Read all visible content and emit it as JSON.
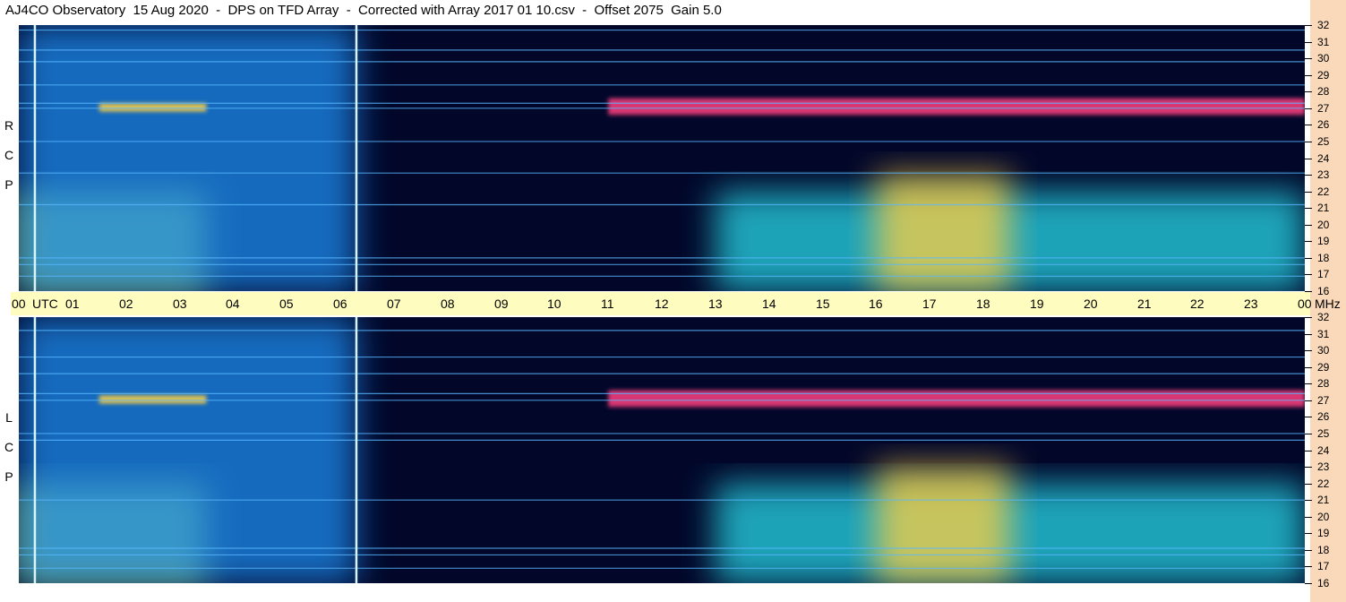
{
  "title": "AJ4CO Observatory  15 Aug 2020  -  DPS on TFD Array  -  Corrected with Array 2017 01 10.csv  -  Offset 2075  Gain 5.0",
  "chart_data": [
    {
      "type": "heatmap",
      "polarization_label": [
        "R",
        "C",
        "P"
      ],
      "x_label": "UTC",
      "y_label": "MHz",
      "x_ticks": [
        "00",
        "01",
        "02",
        "03",
        "04",
        "05",
        "06",
        "07",
        "08",
        "09",
        "10",
        "11",
        "12",
        "13",
        "14",
        "15",
        "16",
        "17",
        "18",
        "19",
        "20",
        "21",
        "22",
        "23",
        "00"
      ],
      "y_ticks": [
        "32",
        "31",
        "30",
        "29",
        "28",
        "27",
        "26",
        "25",
        "24",
        "23",
        "22",
        "21",
        "20",
        "19",
        "18",
        "17",
        "16"
      ],
      "xlim_hours": [
        0,
        24
      ],
      "ylim_mhz": [
        16,
        32
      ],
      "colormap": [
        "#02072a",
        "#0a1a8a",
        "#1540d8",
        "#1e8cf0",
        "#28d8e8",
        "#b8f060",
        "#ffd040",
        "#ff4080",
        "#ffffff"
      ],
      "time_markers_hours": [
        0.3,
        6.3
      ],
      "horizontal_bands_mhz": [
        31.7,
        30.5,
        29.8,
        28.4,
        27.3,
        27.0,
        25.0,
        23.1,
        21.2,
        18.0,
        17.6,
        16.9
      ],
      "bright_regions": [
        {
          "x_hours": [
            0,
            3.5
          ],
          "y_mhz": [
            16,
            22
          ],
          "level": 0.65
        },
        {
          "x_hours": [
            0,
            6.3
          ],
          "y_mhz": [
            16,
            32
          ],
          "level": 0.4
        },
        {
          "x_hours": [
            13,
            24
          ],
          "y_mhz": [
            16,
            22
          ],
          "level": 0.55
        },
        {
          "x_hours": [
            16,
            18.5
          ],
          "y_mhz": [
            16,
            23
          ],
          "level": 0.8
        },
        {
          "x_hours": [
            11,
            24
          ],
          "y_mhz": [
            26.6,
            27.6
          ],
          "level": 0.85
        },
        {
          "x_hours": [
            1.5,
            3.5
          ],
          "y_mhz": [
            26.8,
            27.3
          ],
          "level": 0.7
        }
      ]
    },
    {
      "type": "heatmap",
      "polarization_label": [
        "L",
        "C",
        "P"
      ],
      "x_label": "UTC",
      "y_label": "MHz",
      "x_ticks": [
        "00",
        "01",
        "02",
        "03",
        "04",
        "05",
        "06",
        "07",
        "08",
        "09",
        "10",
        "11",
        "12",
        "13",
        "14",
        "15",
        "16",
        "17",
        "18",
        "19",
        "20",
        "21",
        "22",
        "23",
        "00"
      ],
      "y_ticks": [
        "32",
        "31",
        "30",
        "29",
        "28",
        "27",
        "26",
        "25",
        "24",
        "23",
        "22",
        "21",
        "20",
        "19",
        "18",
        "17",
        "16"
      ],
      "xlim_hours": [
        0,
        24
      ],
      "ylim_mhz": [
        16,
        32
      ],
      "colormap": [
        "#02072a",
        "#0a1a8a",
        "#1540d8",
        "#1e8cf0",
        "#28d8e8",
        "#b8f060",
        "#ffd040",
        "#ff4080",
        "#ffffff"
      ],
      "time_markers_hours": [
        0.3,
        6.3
      ],
      "horizontal_bands_mhz": [
        31.2,
        29.6,
        28.6,
        27.4,
        27.0,
        25.0,
        24.6,
        21.0,
        18.1,
        17.7,
        16.9
      ],
      "bright_regions": [
        {
          "x_hours": [
            0,
            3.5
          ],
          "y_mhz": [
            16,
            22
          ],
          "level": 0.6
        },
        {
          "x_hours": [
            0,
            6.3
          ],
          "y_mhz": [
            16,
            32
          ],
          "level": 0.4
        },
        {
          "x_hours": [
            13,
            24
          ],
          "y_mhz": [
            16,
            22
          ],
          "level": 0.55
        },
        {
          "x_hours": [
            16,
            18.5
          ],
          "y_mhz": [
            16,
            23
          ],
          "level": 0.8
        },
        {
          "x_hours": [
            11,
            24
          ],
          "y_mhz": [
            26.6,
            27.6
          ],
          "level": 0.85
        },
        {
          "x_hours": [
            1.5,
            3.5
          ],
          "y_mhz": [
            26.8,
            27.3
          ],
          "level": 0.7
        }
      ]
    }
  ]
}
